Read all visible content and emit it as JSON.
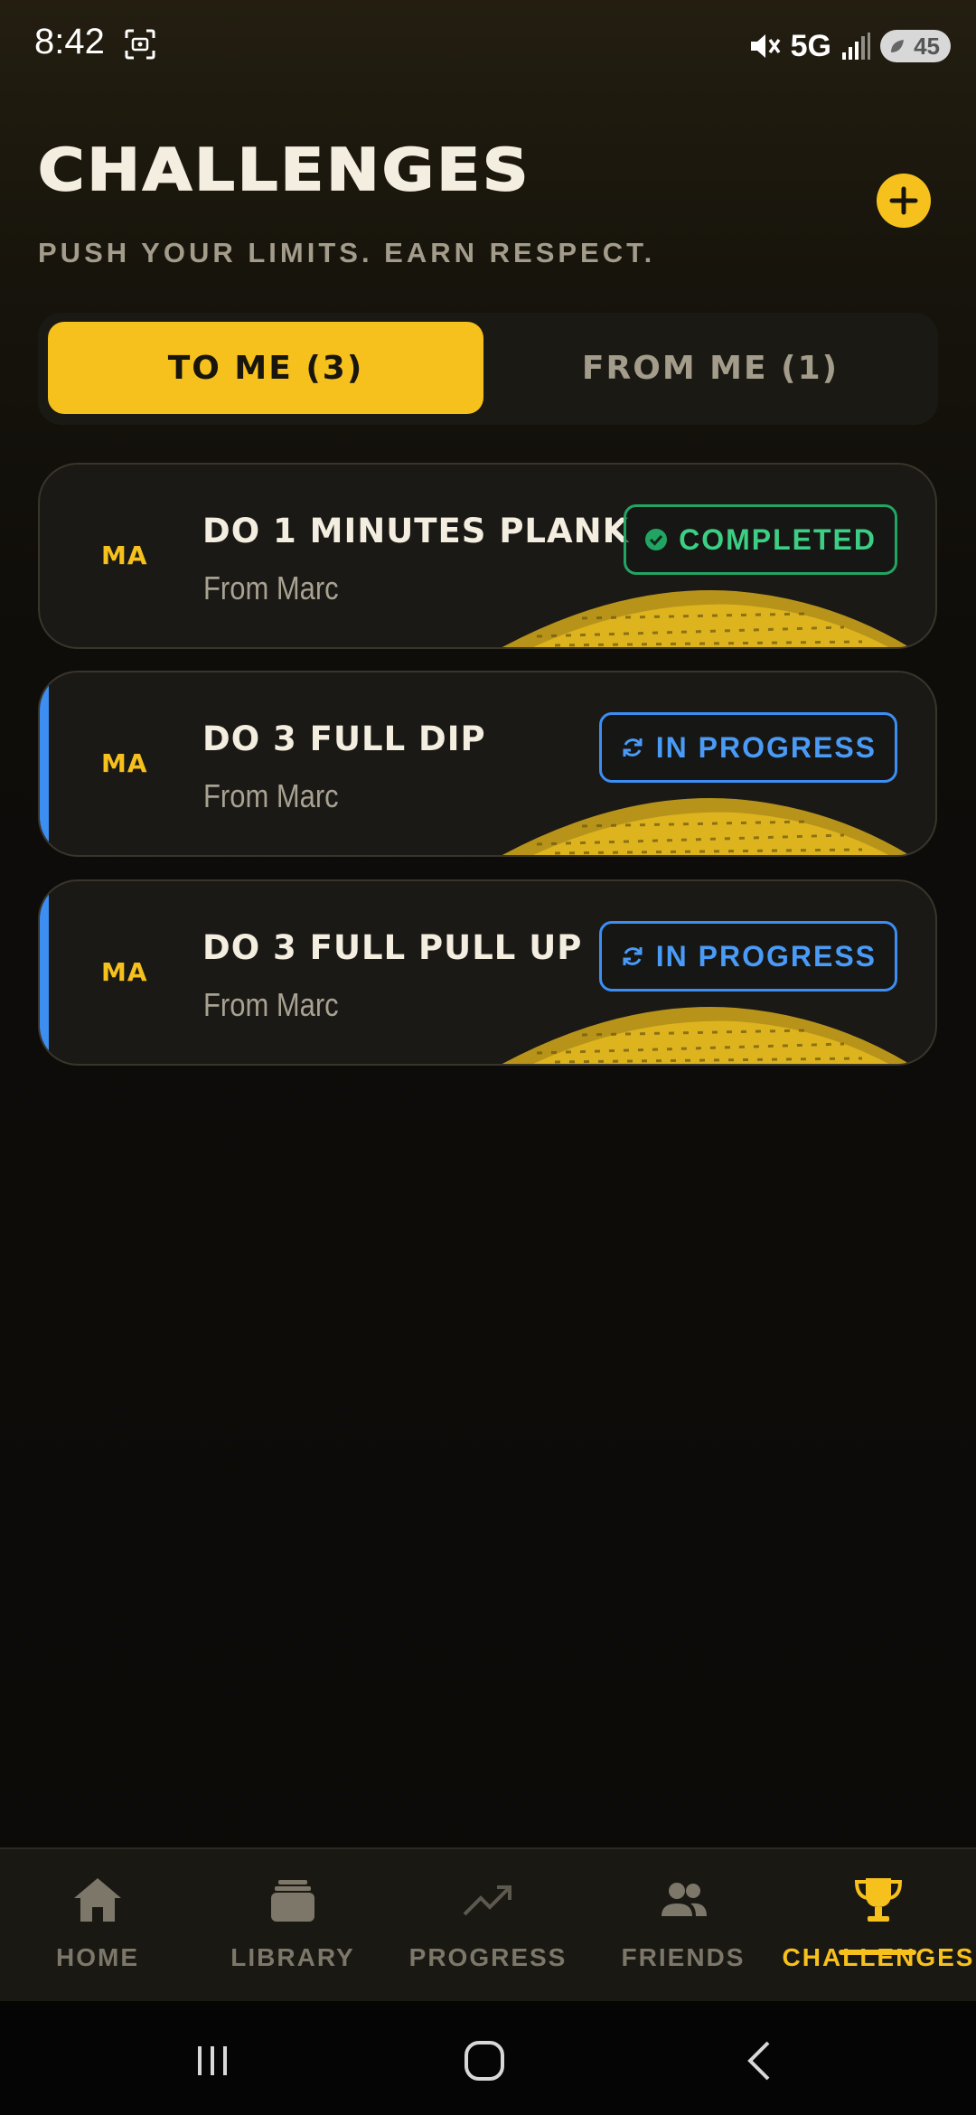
{
  "status_bar": {
    "time": "8:42",
    "network": "5G",
    "battery": "45"
  },
  "header": {
    "title": "CHALLENGES",
    "subtitle": "PUSH YOUR LIMITS. EARN RESPECT.",
    "add_icon": "plus-icon"
  },
  "tabs": [
    {
      "label": "TO ME (3)",
      "active": true
    },
    {
      "label": "FROM ME (1)",
      "active": false
    }
  ],
  "challenges": [
    {
      "avatar": "MA",
      "title": "DO 1 MINUTES PLANK",
      "from": "From Marc",
      "status": "COMPLETED",
      "status_icon": "check-circle-icon"
    },
    {
      "avatar": "MA",
      "title": "DO 3 FULL DIP",
      "from": "From Marc",
      "status": "IN PROGRESS",
      "status_icon": "refresh-icon"
    },
    {
      "avatar": "MA",
      "title": "DO 3 FULL PULL UP",
      "from": "From Marc",
      "status": "IN PROGRESS",
      "status_icon": "refresh-icon"
    }
  ],
  "bottom_nav": [
    {
      "label": "HOME",
      "icon": "home-icon",
      "active": false
    },
    {
      "label": "LIBRARY",
      "icon": "library-icon",
      "active": false
    },
    {
      "label": "PROGRESS",
      "icon": "trending-up-icon",
      "active": false
    },
    {
      "label": "FRIENDS",
      "icon": "friends-icon",
      "active": false
    },
    {
      "label": "CHALLENGES",
      "icon": "trophy-icon",
      "active": true
    }
  ],
  "colors": {
    "accent": "#f6c11d",
    "completed": "#22a563",
    "in_progress": "#3c8ef3",
    "background": "#0e0c09"
  }
}
